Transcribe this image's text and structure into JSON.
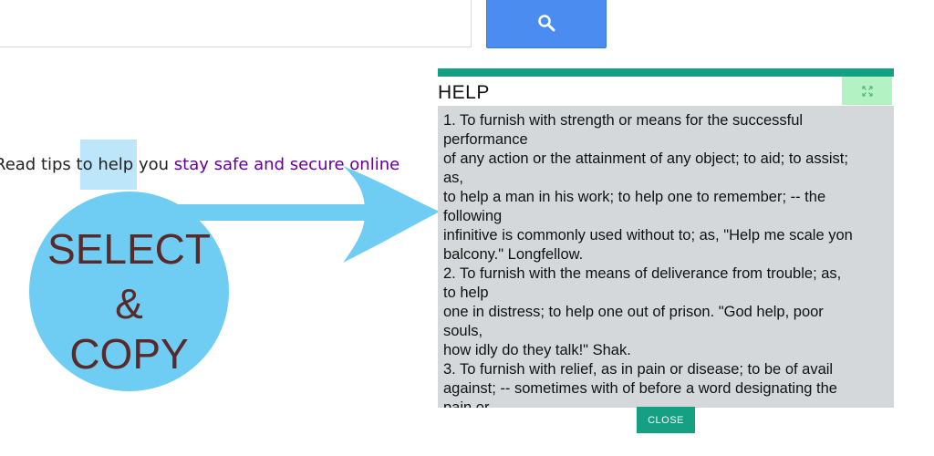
{
  "search": {
    "input_value": "",
    "button_icon": "search-icon"
  },
  "tip": {
    "prefix": "Read tips to help you ",
    "link_text": "stay safe and secure online"
  },
  "overlay": {
    "line1": "SELECT",
    "line2": "&",
    "line3": "COPY"
  },
  "help": {
    "title": "HELP",
    "expand_icon": "expand-icon",
    "lines": [
      "1. To furnish with strength or means for the successful",
      "performance",
      "of any action or the attainment of any object; to aid; to assist;",
      "as,",
      "to help a man in his work; to help one to remember; -- the",
      "following",
      "infinitive is commonly used without to; as, \"Help me scale yon",
      "balcony.\" Longfellow.",
      "2. To furnish with the means of deliverance from trouble; as,",
      "to help",
      "one in distress; to help one out of prison. \"God help, poor",
      "souls,",
      "how idly do they talk!\" Shak.",
      "3. To furnish with relief, as in pain or disease; to be of avail",
      "against; -- sometimes with of before a word designating the",
      "pain or"
    ],
    "close_label": "CLOSE"
  },
  "colors": {
    "accent": "#16a083",
    "search_button": "#4a8cf0",
    "bubble": "#6fcdf3",
    "link": "#660099"
  }
}
